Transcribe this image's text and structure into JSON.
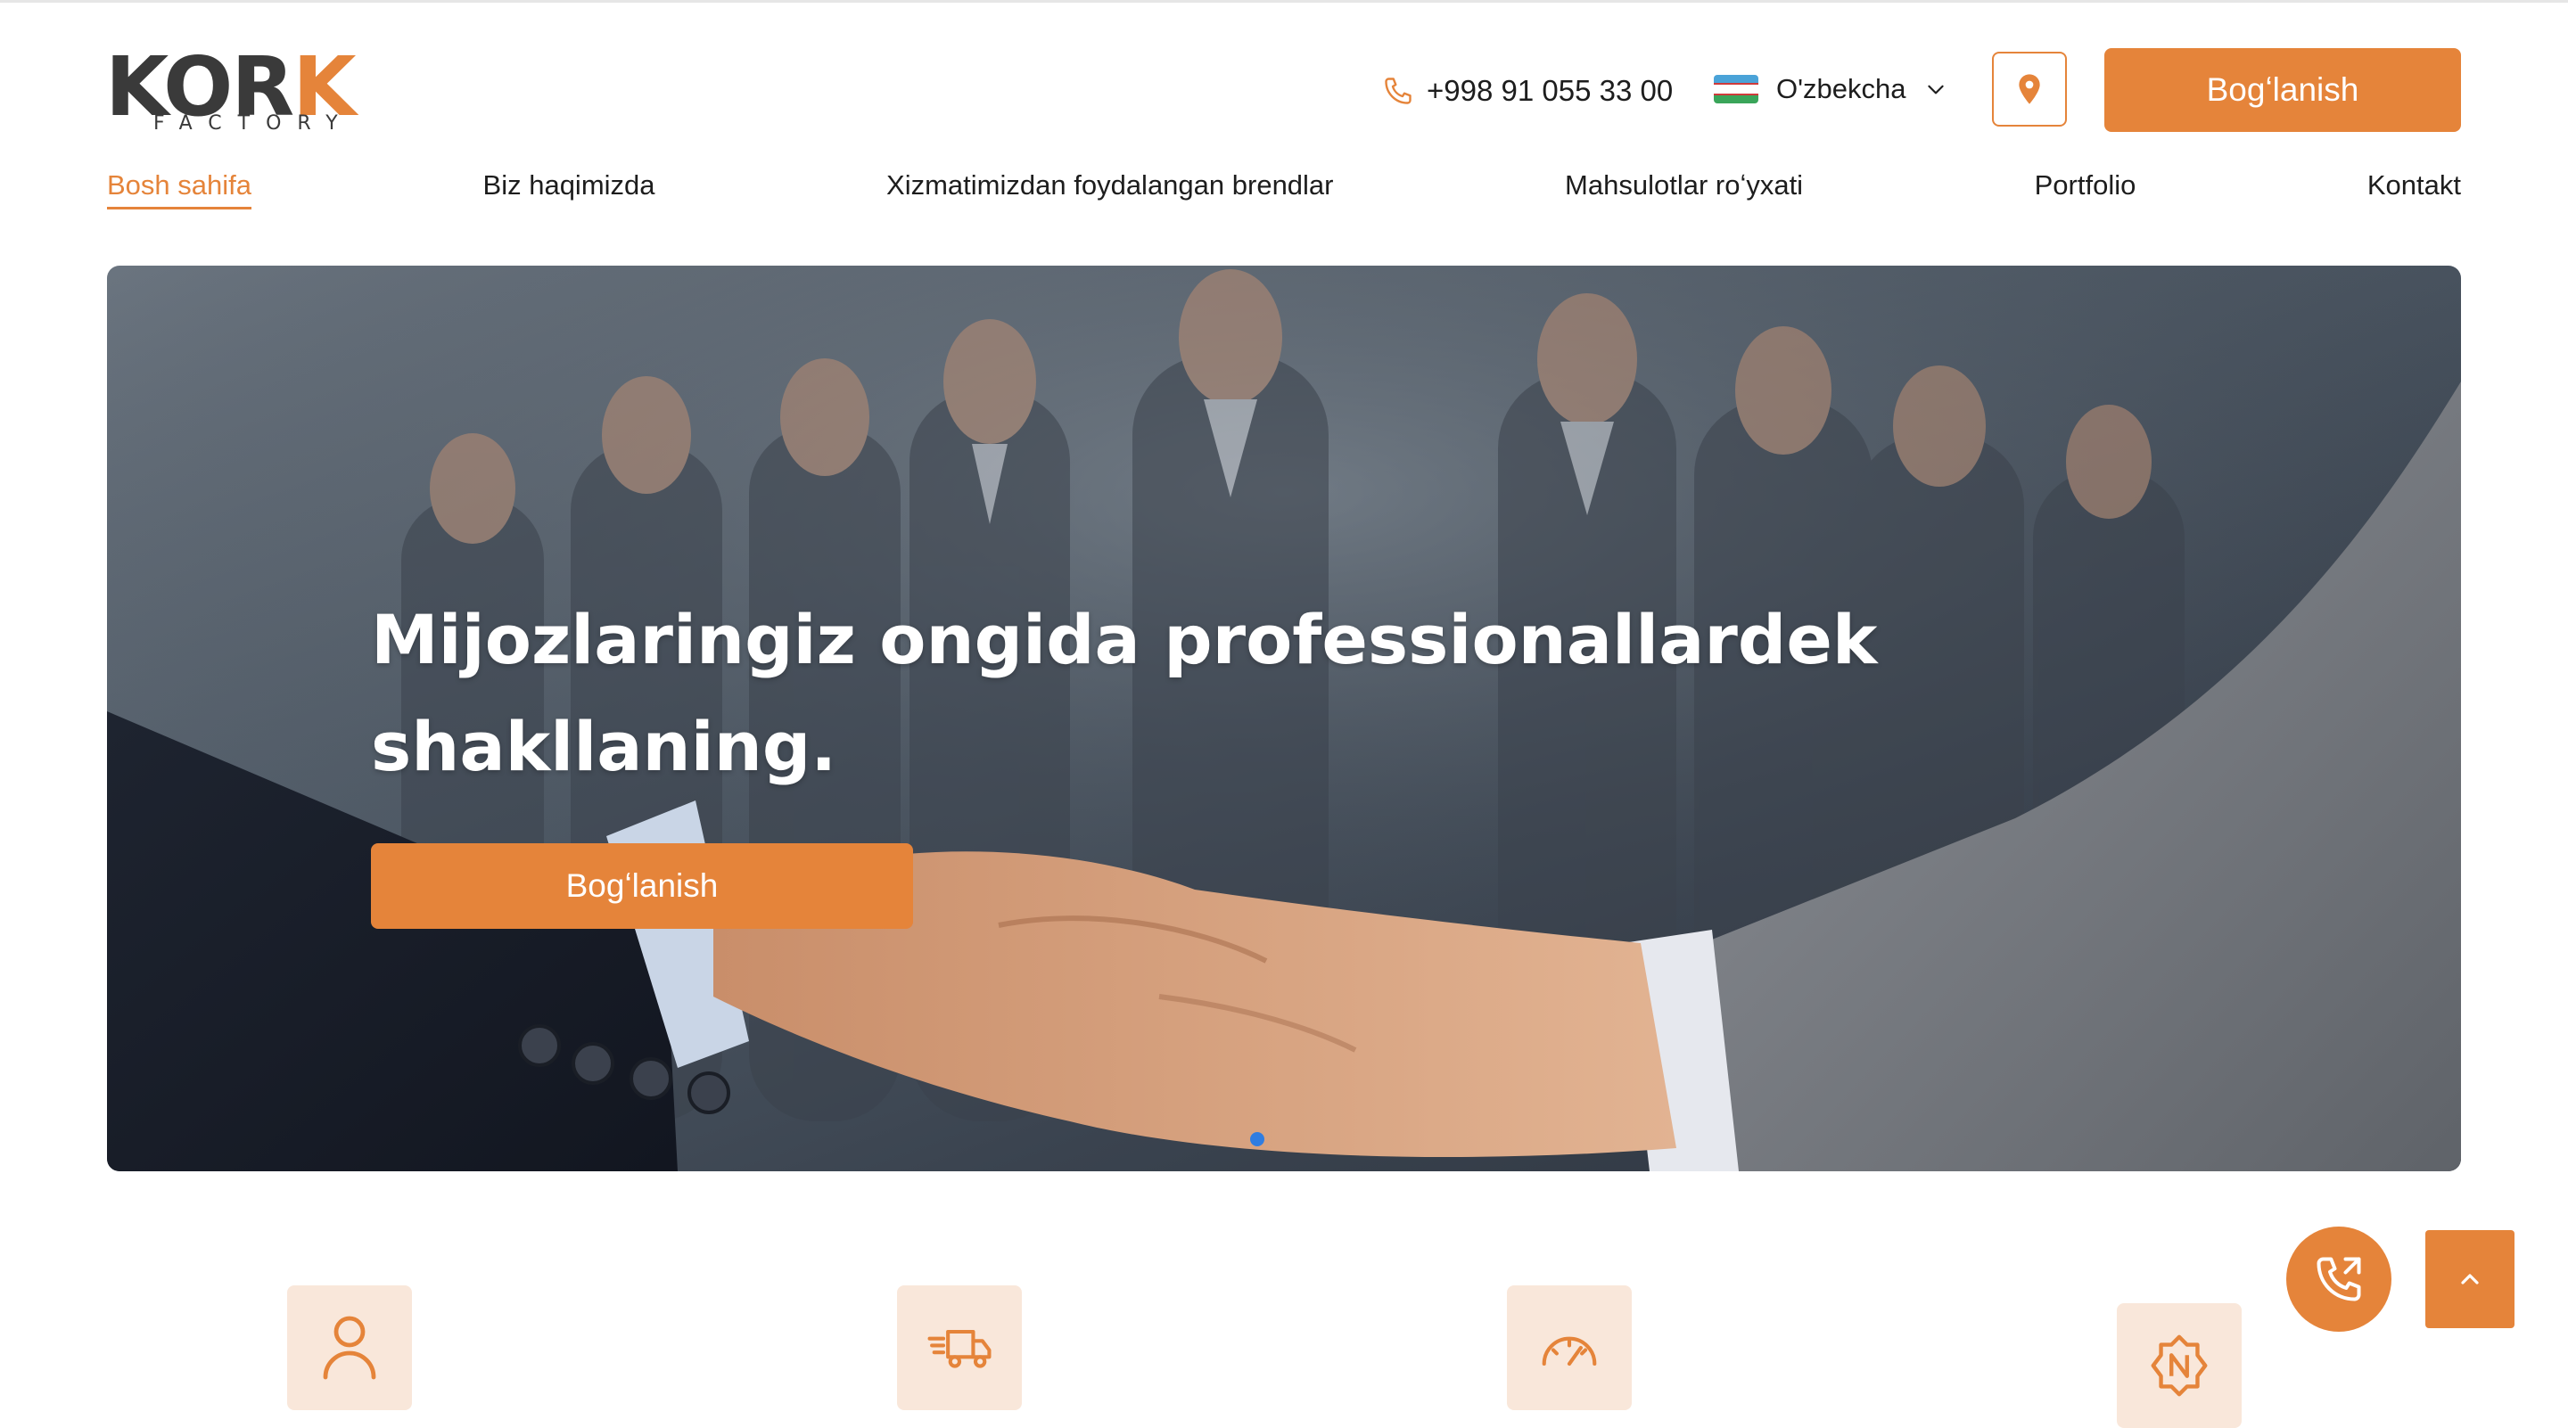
{
  "header": {
    "logo": {
      "word_dark": "KOR",
      "word_accent": "K",
      "subtitle": "FACTORY"
    },
    "phone": "+998 91 055 33 00",
    "language": "O'zbekcha",
    "cta_label": "Bogʻlanish"
  },
  "nav": {
    "items": [
      {
        "label": "Bosh sahifa",
        "active": true
      },
      {
        "label": "Biz haqimizda"
      },
      {
        "label": "Xizmatimizdan foydalangan brendlar"
      },
      {
        "label": "Mahsulotlar roʻyxati"
      },
      {
        "label": "Portfolio"
      },
      {
        "label": "Kontakt"
      }
    ]
  },
  "hero": {
    "title_line1": "Mijozlaringiz ongida professionallardek",
    "title_line2": "shakllaning.",
    "cta_label": "Bogʻlanish",
    "slide_indicator": {
      "active": 1
    }
  },
  "features": [
    {
      "icon": "user-icon"
    },
    {
      "icon": "delivery-truck-icon"
    },
    {
      "icon": "speedometer-icon"
    },
    {
      "icon": "quality-badge-icon"
    }
  ],
  "colors": {
    "accent": "#e5843a",
    "feature_bg": "#f9e7da",
    "dot": "#2f7de1"
  }
}
